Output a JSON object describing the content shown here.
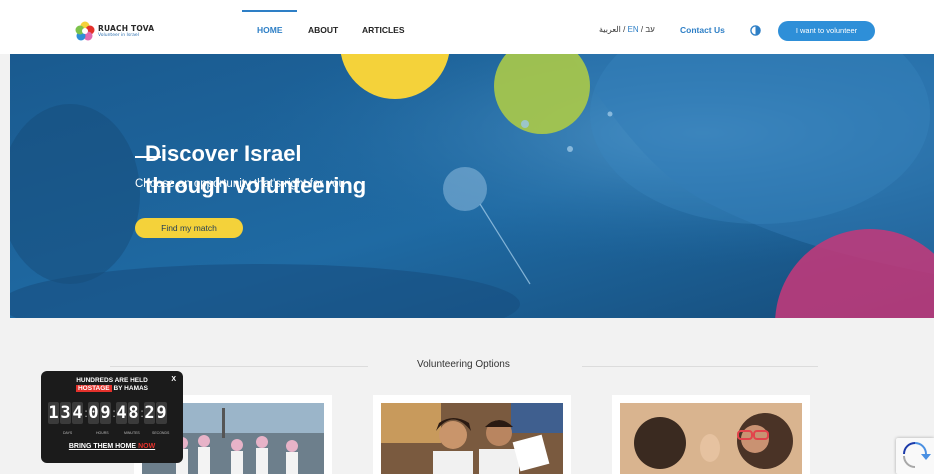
{
  "header": {
    "logo_title": "RUACH TOVA",
    "logo_subtitle": "Volunteer in Israel",
    "nav": [
      {
        "label": "HOME",
        "active": true
      },
      {
        "label": "ABOUT",
        "active": false
      },
      {
        "label": "ARTICLES",
        "active": false
      }
    ],
    "languages": {
      "he": "עב",
      "sep1": " / ",
      "en": "EN",
      "sep2": " / ",
      "ar": "العربية"
    },
    "contact_label": "Contact Us",
    "contrast_icon": "contrast-icon",
    "volunteer_label": "I want to volunteer",
    "accent_color": "#2e7fc6"
  },
  "hero": {
    "title_line1": "Discover Israel",
    "title_line2": "through volunteering",
    "subtitle": "Choose an opportunity that's right for you",
    "cta_label": "Find my match"
  },
  "options": {
    "title": "Volunteering Options"
  },
  "hostage_widget": {
    "line1": "HUNDREDS ARE HELD",
    "line2_highlight": "HOSTAGE",
    "line2_rest": " BY HAMAS",
    "close": "X",
    "days": "134",
    "hours": "09",
    "minutes": "48",
    "seconds": "29",
    "unit_days": "DAYS",
    "unit_hours": "HOURS",
    "unit_minutes": "MINUTES",
    "unit_seconds": "SECONDS",
    "bring_text": "BRING THEM HOME ",
    "bring_now": "NOW"
  }
}
